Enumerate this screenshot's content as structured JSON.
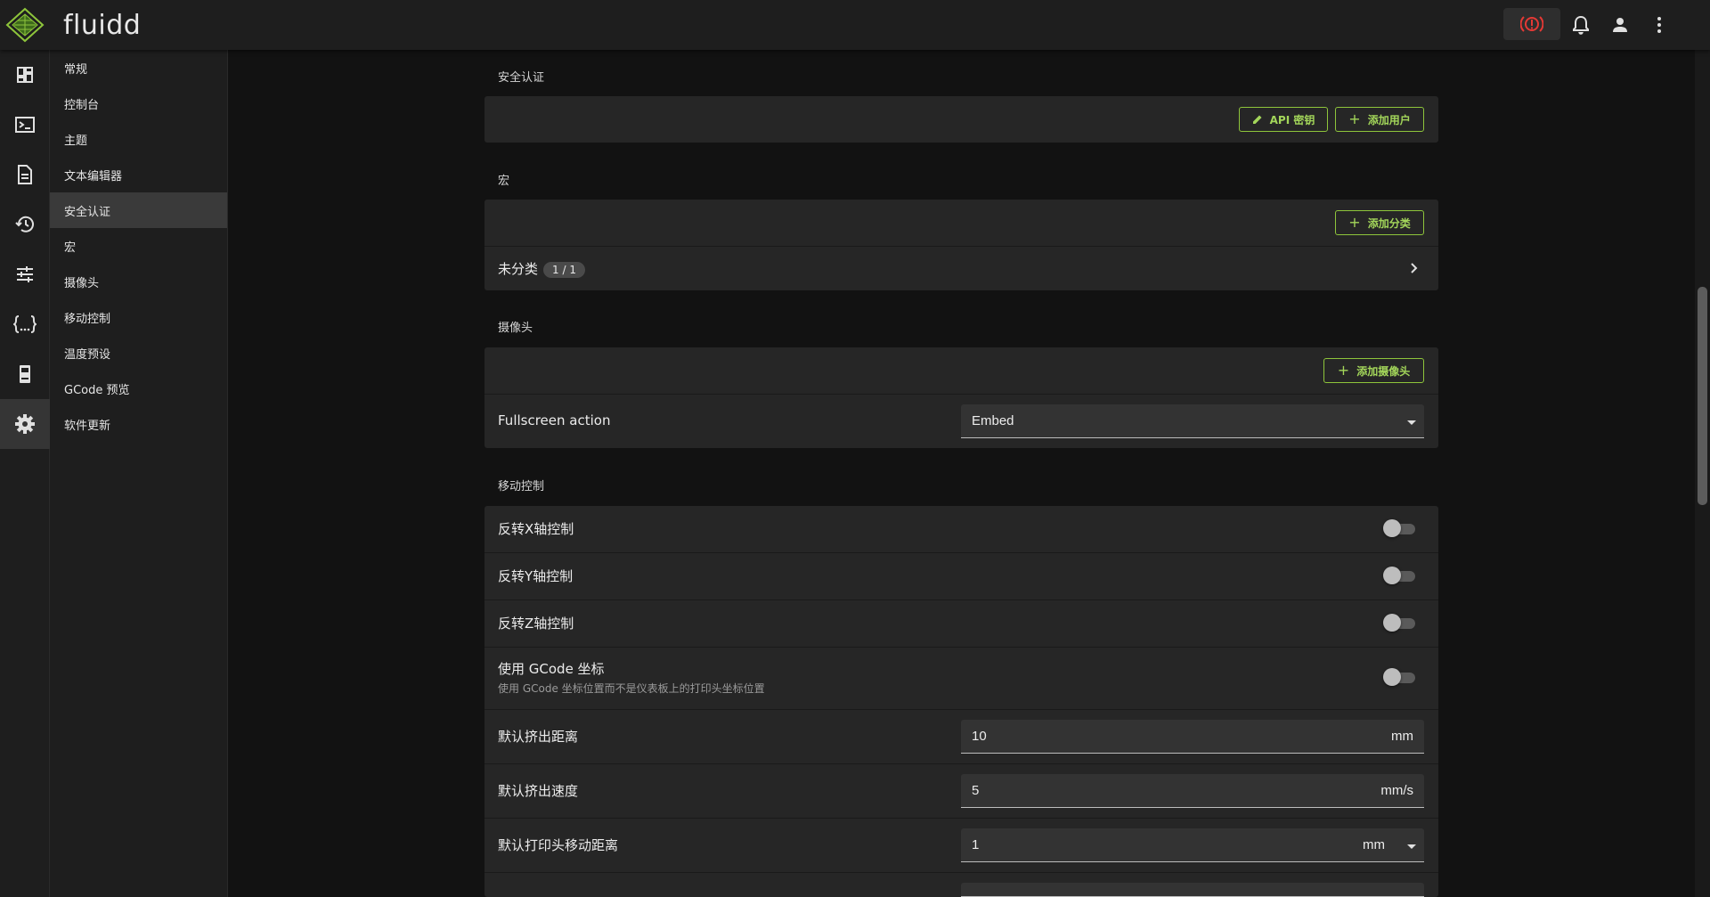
{
  "app": {
    "brand": "fluidd"
  },
  "colors": {
    "accent": "#8ec53b",
    "emergency": "#e53935",
    "background": "#121212",
    "surface": "#262626"
  },
  "topbar_icons": [
    "emergency-stop-icon",
    "bell-icon",
    "account-icon",
    "more-vert-icon"
  ],
  "rail": {
    "items": [
      {
        "icon": "dashboard-icon"
      },
      {
        "icon": "console-icon"
      },
      {
        "icon": "file-icon"
      },
      {
        "icon": "history-icon"
      },
      {
        "icon": "tune-icon"
      },
      {
        "icon": "code-braces-icon"
      },
      {
        "icon": "printer-icon"
      },
      {
        "icon": "gear-icon",
        "active": true
      }
    ]
  },
  "subnav": {
    "items": [
      {
        "label": "常规"
      },
      {
        "label": "控制台"
      },
      {
        "label": "主题"
      },
      {
        "label": "文本编辑器"
      },
      {
        "label": "安全认证",
        "active": true
      },
      {
        "label": "宏"
      },
      {
        "label": "摄像头"
      },
      {
        "label": "移动控制"
      },
      {
        "label": "温度预设"
      },
      {
        "label": "GCode 预览"
      },
      {
        "label": "软件更新"
      }
    ]
  },
  "auth": {
    "title": "安全认证",
    "api_key_button": "API 密钥",
    "add_user_button": "添加用户"
  },
  "macros": {
    "title": "宏",
    "add_category_button": "添加分类",
    "category_label": "未分类",
    "category_count": "1 / 1"
  },
  "cameras": {
    "title": "摄像头",
    "add_camera_button": "添加摄像头",
    "fullscreen_label": "Fullscreen action",
    "fullscreen_value": "Embed"
  },
  "motion": {
    "title": "移动控制",
    "invert_x": "反转X轴控制",
    "invert_y": "反转Y轴控制",
    "invert_z": "反转Z轴控制",
    "use_gcode_coords": "使用 GCode 坐标",
    "use_gcode_coords_desc": "使用 GCode 坐标位置而不是仪表板上的打印头坐标位置",
    "extrude_distance_label": "默认挤出距离",
    "extrude_distance_value": "10",
    "extrude_distance_unit": "mm",
    "extrude_speed_label": "默认挤出速度",
    "extrude_speed_value": "5",
    "extrude_speed_unit": "mm/s",
    "move_distance_label": "默认打印头移动距离",
    "move_distance_value": "1",
    "move_distance_unit": "mm",
    "toggles": {
      "invert_x": false,
      "invert_y": false,
      "invert_z": false,
      "use_gcode_coords": false
    }
  }
}
